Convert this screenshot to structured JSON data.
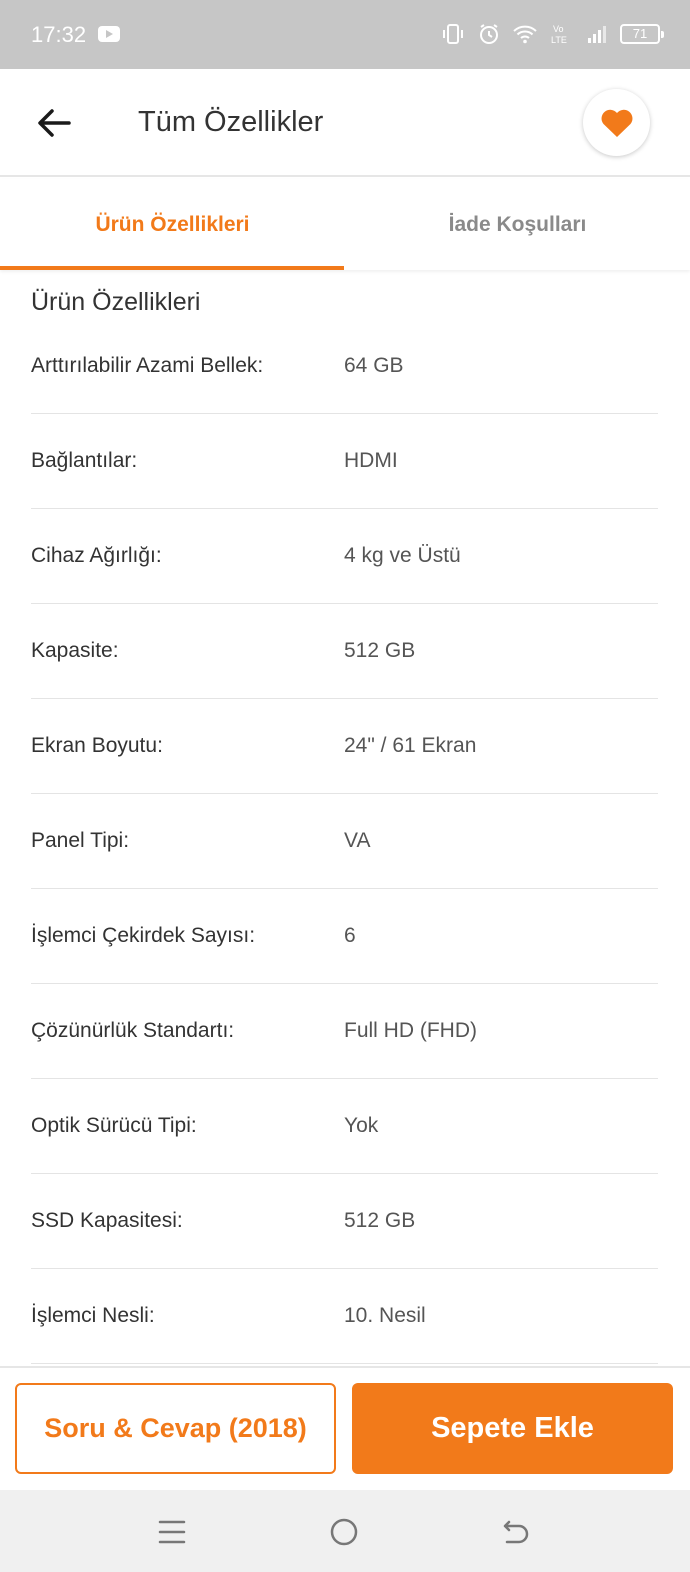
{
  "status_bar": {
    "time": "17:32",
    "battery": "71",
    "icons": [
      "youtube-icon",
      "vibrate-icon",
      "alarm-icon",
      "wifi-icon",
      "volte-icon",
      "signal-icon",
      "battery-icon"
    ]
  },
  "header": {
    "title": "Tüm Özellikler",
    "back_icon": "arrow-left-icon",
    "favorite_icon": "heart-icon"
  },
  "tabs": [
    {
      "label": "Ürün Özellikleri",
      "active": true
    },
    {
      "label": "İade Koşulları",
      "active": false
    }
  ],
  "section": {
    "title": "Ürün Özellikleri",
    "specs": [
      {
        "label": "Arttırılabilir Azami Bellek:",
        "value": "64 GB"
      },
      {
        "label": "Bağlantılar:",
        "value": "HDMI"
      },
      {
        "label": "Cihaz Ağırlığı:",
        "value": "4 kg ve Üstü"
      },
      {
        "label": "Kapasite:",
        "value": "512 GB"
      },
      {
        "label": "Ekran Boyutu:",
        "value": "24\" / 61 Ekran"
      },
      {
        "label": "Panel Tipi:",
        "value": "VA"
      },
      {
        "label": "İşlemci Çekirdek Sayısı:",
        "value": "6"
      },
      {
        "label": "Çözünürlük Standartı:",
        "value": "Full HD (FHD)"
      },
      {
        "label": "Optik Sürücü Tipi:",
        "value": "Yok"
      },
      {
        "label": "SSD Kapasitesi:",
        "value": "512 GB"
      },
      {
        "label": "İşlemci Nesli:",
        "value": "10. Nesil"
      }
    ]
  },
  "actions": {
    "qa_label": "Soru & Cevap (2018)",
    "cart_label": "Sepete Ekle"
  },
  "colors": {
    "accent": "#f27a1a",
    "status_bar": "#c6c6c6",
    "divider": "#e4e4e4"
  },
  "nav_bar": {
    "icons": [
      "menu-icon",
      "home-icon",
      "back-icon"
    ]
  }
}
